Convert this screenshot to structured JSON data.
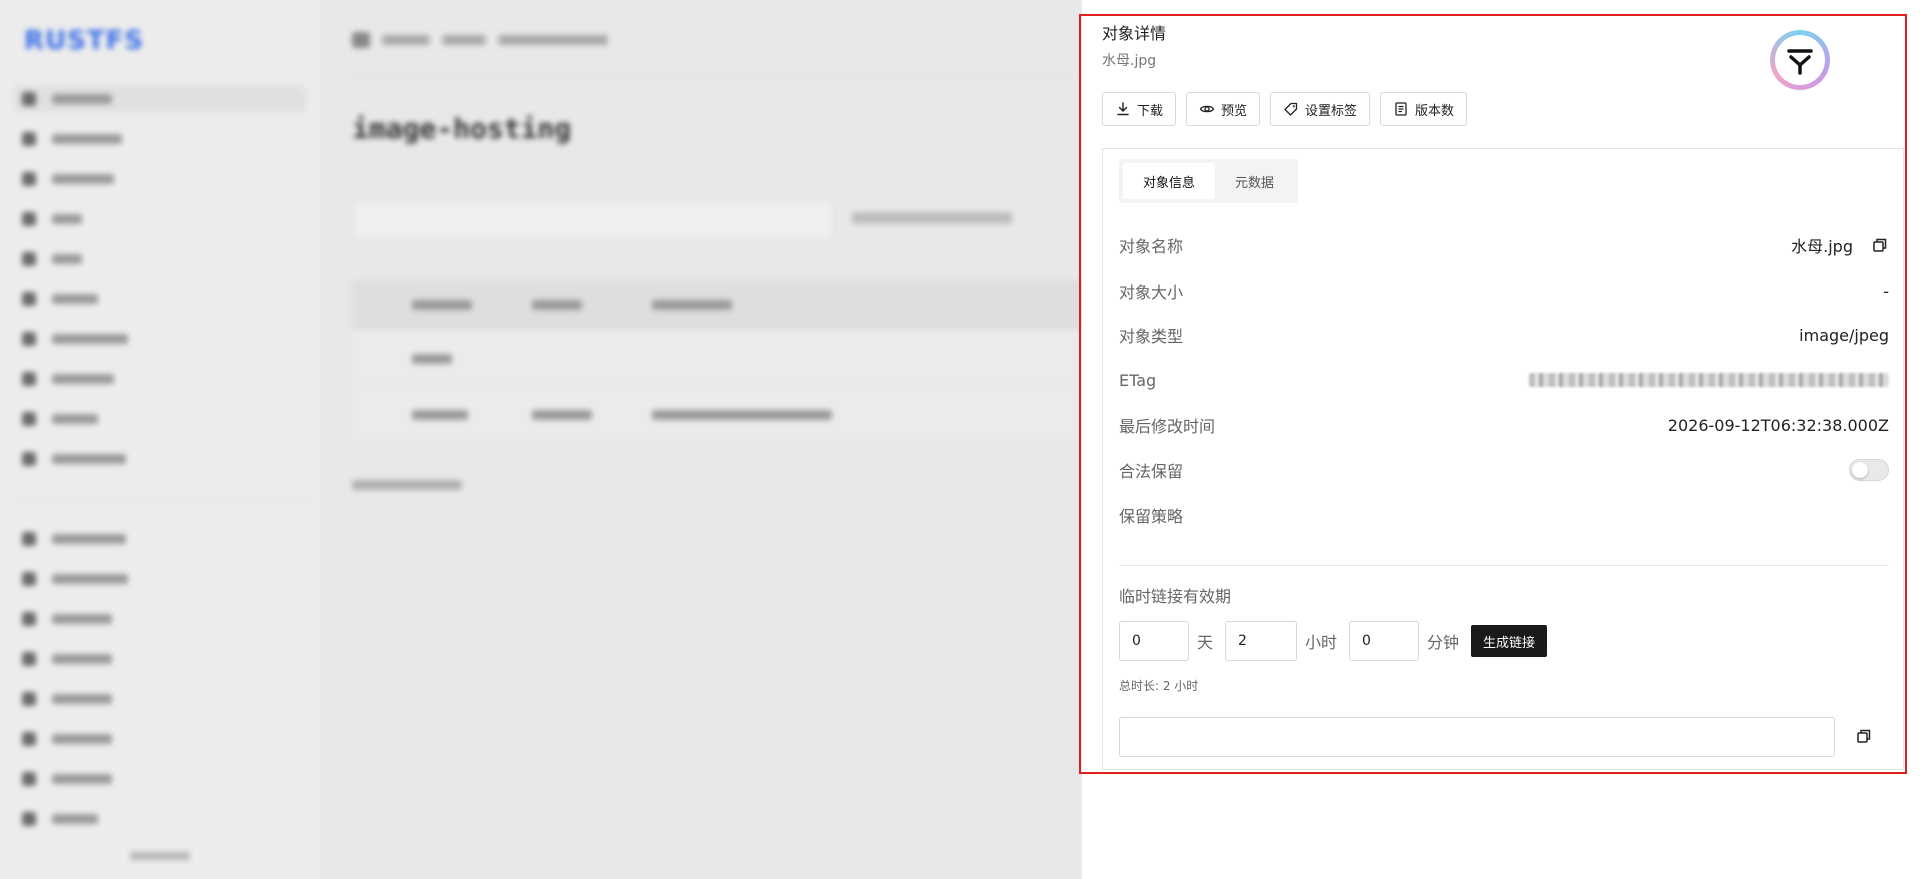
{
  "background": {
    "logo": "RUSTFS",
    "page_title": "image-hosting"
  },
  "drawer": {
    "title": "对象详情",
    "subtitle": "水母.jpg",
    "toolbar": {
      "download": "下载",
      "preview": "预览",
      "set_tags": "设置标签",
      "versions": "版本数"
    },
    "tabs": {
      "info": "对象信息",
      "metadata": "元数据"
    },
    "fields": {
      "name_label": "对象名称",
      "name_value": "水母.jpg",
      "size_label": "对象大小",
      "size_value": "-",
      "type_label": "对象类型",
      "type_value": "image/jpeg",
      "etag_label": "ETag",
      "modified_label": "最后修改时间",
      "modified_value": "2026-09-12T06:32:38.000Z",
      "legal_hold_label": "合法保留",
      "retention_label": "保留策略"
    },
    "expiry": {
      "label": "临时链接有效期",
      "days_value": "0",
      "days_unit": "天",
      "hours_value": "2",
      "hours_unit": "小时",
      "minutes_value": "0",
      "minutes_unit": "分钟",
      "generate_label": "生成链接",
      "total_text": "总时长: 2 小时"
    }
  },
  "colors": {
    "highlight_border": "#e02020",
    "primary_button": "#1a1a1a"
  }
}
